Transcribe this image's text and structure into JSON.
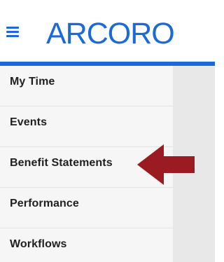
{
  "header": {
    "logo_text": "ARCORO",
    "brand_color": "#1b6ad8"
  },
  "sidebar": {
    "items": [
      {
        "label": "My Time"
      },
      {
        "label": "Events"
      },
      {
        "label": "Benefit Statements"
      },
      {
        "label": "Performance"
      },
      {
        "label": "Workflows"
      }
    ]
  },
  "annotation": {
    "arrow_color": "#9b1b22",
    "points_to": "Benefit Statements"
  }
}
